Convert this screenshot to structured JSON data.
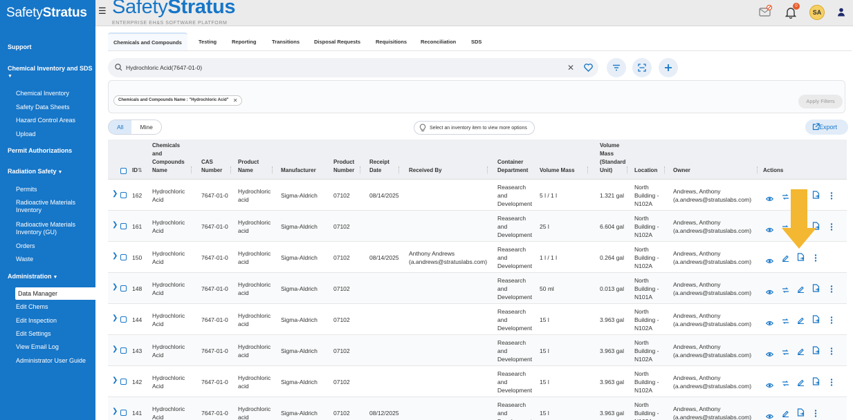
{
  "brand": {
    "sidebar_name_light": "Safety",
    "sidebar_name_bold": "Stratus",
    "header_name_light": "Safety",
    "header_name_bold": "Stratus",
    "tagline": "ENTERPRISE EH&S SOFTWARE PLATFORM"
  },
  "user": {
    "initials": "SA",
    "notification_count": "0"
  },
  "sidebar": {
    "support": "Support",
    "chem_section": "Chemical Inventory and SDS",
    "chem_items": [
      "Chemical Inventory",
      "Safety Data Sheets",
      "Hazard Control Areas",
      "Upload"
    ],
    "permit_auth": "Permit Authorizations",
    "radiation": "Radiation Safety",
    "radiation_items": [
      "Permits",
      "Radioactive Materials Inventory",
      "Radioactive Materials Inventory (GU)",
      "Orders",
      "Waste"
    ],
    "admin": "Administration",
    "admin_items": [
      "Data Manager",
      "Edit Chems",
      "Edit Inspection",
      "Edit Settings",
      "View Email Log",
      "Administrator User Guide"
    ]
  },
  "tabs": [
    "Chemicals and Compounds",
    "Testing",
    "Reporting",
    "Transitions",
    "Disposal Requests",
    "Requisitions",
    "Reconciliation",
    "SDS"
  ],
  "search": {
    "value": "Hydrochloric Acid(7647-01-0)"
  },
  "filter": {
    "chip": "Chemicals and Compounds Name : \"Hydrochloric Acid\"",
    "apply": "Apply Filters"
  },
  "view_toggle": {
    "all": "All",
    "mine": "Mine"
  },
  "hint": "Select an inventory item to view more options",
  "export": "Export",
  "columns": {
    "id": "ID",
    "name": [
      "Chemicals",
      "and",
      "Compounds",
      "Name"
    ],
    "cas": [
      "CAS",
      "Number"
    ],
    "product_name": [
      "Product",
      "Name"
    ],
    "manufacturer": "Manufacturer",
    "product_number": [
      "Product",
      "Number"
    ],
    "receipt": [
      "Receipt",
      "Date"
    ],
    "received_by": "Received By",
    "dept": [
      "Container",
      "Department"
    ],
    "volume": "Volume Mass",
    "std": [
      "Volume",
      "Mass",
      "(Standard",
      "Unit)"
    ],
    "location": "Location",
    "owner": "Owner",
    "actions": "Actions"
  },
  "rows": [
    {
      "id": "162",
      "name": [
        "Hydrochloric",
        "Acid"
      ],
      "cas": "7647-01-0",
      "product": [
        "Hydrochloric",
        "acid"
      ],
      "manufacturer": "Sigma-Aldrich",
      "pnum": "07102",
      "receipt": "08/14/2025",
      "received_by": [
        "",
        ""
      ],
      "dept": [
        "Reasearch",
        "and",
        "Development"
      ],
      "volume": "5 l / 1 l",
      "std": "1.321 gal",
      "location": [
        "North",
        "Building -",
        "N102A"
      ],
      "owner": [
        "Andrews, Anthony",
        "(a.andrews@stratuslabs.com)"
      ]
    },
    {
      "id": "161",
      "name": [
        "Hydrochloric",
        "Acid"
      ],
      "cas": "7647-01-0",
      "product": [
        "Hydrochloric",
        "acid"
      ],
      "manufacturer": "Sigma-Aldrich",
      "pnum": "07102",
      "receipt": "",
      "received_by": [
        "",
        ""
      ],
      "dept": [
        "Reasearch",
        "and",
        "Development"
      ],
      "volume": "25 l",
      "std": "6.604 gal",
      "location": [
        "North",
        "Building -",
        "N102A"
      ],
      "owner": [
        "Andrews, Anthony",
        "(a.andrews@stratuslabs.com)"
      ]
    },
    {
      "id": "150",
      "name": [
        "Hydrochloric",
        "Acid"
      ],
      "cas": "7647-01-0",
      "product": [
        "Hydrochloric",
        "acid"
      ],
      "manufacturer": "Sigma-Aldrich",
      "pnum": "07102",
      "receipt": "08/14/2025",
      "received_by": [
        "Anthony Andrews",
        "(a.andrews@stratuslabs.com)"
      ],
      "dept": [
        "Reasearch",
        "and",
        "Development"
      ],
      "volume": "1 l / 1 l",
      "std": "0.264 gal",
      "location": [
        "North",
        "Building -",
        "N102A"
      ],
      "owner": [
        "Andrews, Anthony",
        "(a.andrews@stratuslabs.com)"
      ]
    },
    {
      "id": "148",
      "name": [
        "Hydrochloric",
        "Acid"
      ],
      "cas": "7647-01-0",
      "product": [
        "Hydrochloric",
        "acid"
      ],
      "manufacturer": "Sigma-Aldrich",
      "pnum": "07102",
      "receipt": "",
      "received_by": [
        "",
        ""
      ],
      "dept": [
        "Reasearch",
        "and",
        "Development"
      ],
      "volume": "50 ml",
      "std": "0.013 gal",
      "location": [
        "North",
        "Building -",
        "N101A"
      ],
      "owner": [
        "Andrews, Anthony",
        "(a.andrews@stratuslabs.com)"
      ]
    },
    {
      "id": "144",
      "name": [
        "Hydrochloric",
        "Acid"
      ],
      "cas": "7647-01-0",
      "product": [
        "Hydrochloric",
        "acid"
      ],
      "manufacturer": "Sigma-Aldrich",
      "pnum": "07102",
      "receipt": "",
      "received_by": [
        "",
        ""
      ],
      "dept": [
        "Reasearch",
        "and",
        "Development"
      ],
      "volume": "15 l",
      "std": "3.963 gal",
      "location": [
        "North",
        "Building -",
        "N102A"
      ],
      "owner": [
        "Andrews, Anthony",
        "(a.andrews@stratuslabs.com)"
      ]
    },
    {
      "id": "143",
      "name": [
        "Hydrochloric",
        "Acid"
      ],
      "cas": "7647-01-0",
      "product": [
        "Hydrochloric",
        "acid"
      ],
      "manufacturer": "Sigma-Aldrich",
      "pnum": "07102",
      "receipt": "",
      "received_by": [
        "",
        ""
      ],
      "dept": [
        "Reasearch",
        "and",
        "Development"
      ],
      "volume": "15 l",
      "std": "3.963 gal",
      "location": [
        "North",
        "Building -",
        "N102A"
      ],
      "owner": [
        "Andrews, Anthony",
        "(a.andrews@stratuslabs.com)"
      ]
    },
    {
      "id": "142",
      "name": [
        "Hydrochloric",
        "Acid"
      ],
      "cas": "7647-01-0",
      "product": [
        "Hydrochloric",
        "acid"
      ],
      "manufacturer": "Sigma-Aldrich",
      "pnum": "07102",
      "receipt": "",
      "received_by": [
        "",
        ""
      ],
      "dept": [
        "Reasearch",
        "and",
        "Development"
      ],
      "volume": "15 l",
      "std": "3.963 gal",
      "location": [
        "North",
        "Building -",
        "N102A"
      ],
      "owner": [
        "Andrews, Anthony",
        "(a.andrews@stratuslabs.com)"
      ]
    },
    {
      "id": "141",
      "name": [
        "Hydrochloric",
        "Acid"
      ],
      "cas": "7647-01-0",
      "product": [
        "Hydrochloric",
        "acid"
      ],
      "manufacturer": "Sigma-Aldrich",
      "pnum": "07102",
      "receipt": "08/12/2025",
      "received_by": [
        "",
        ""
      ],
      "dept": [
        "Reasearch",
        "and",
        "Development"
      ],
      "volume": "15 l",
      "std": "3.963 gal",
      "location": [
        "North",
        "Building -",
        "N102A"
      ],
      "owner": [
        "Andrews, Anthony",
        "(a.andrews@stratuslabs.com)"
      ]
    }
  ],
  "colors": {
    "brand_blue": "#1676c8",
    "highlight_arrow": "#f4b731"
  }
}
